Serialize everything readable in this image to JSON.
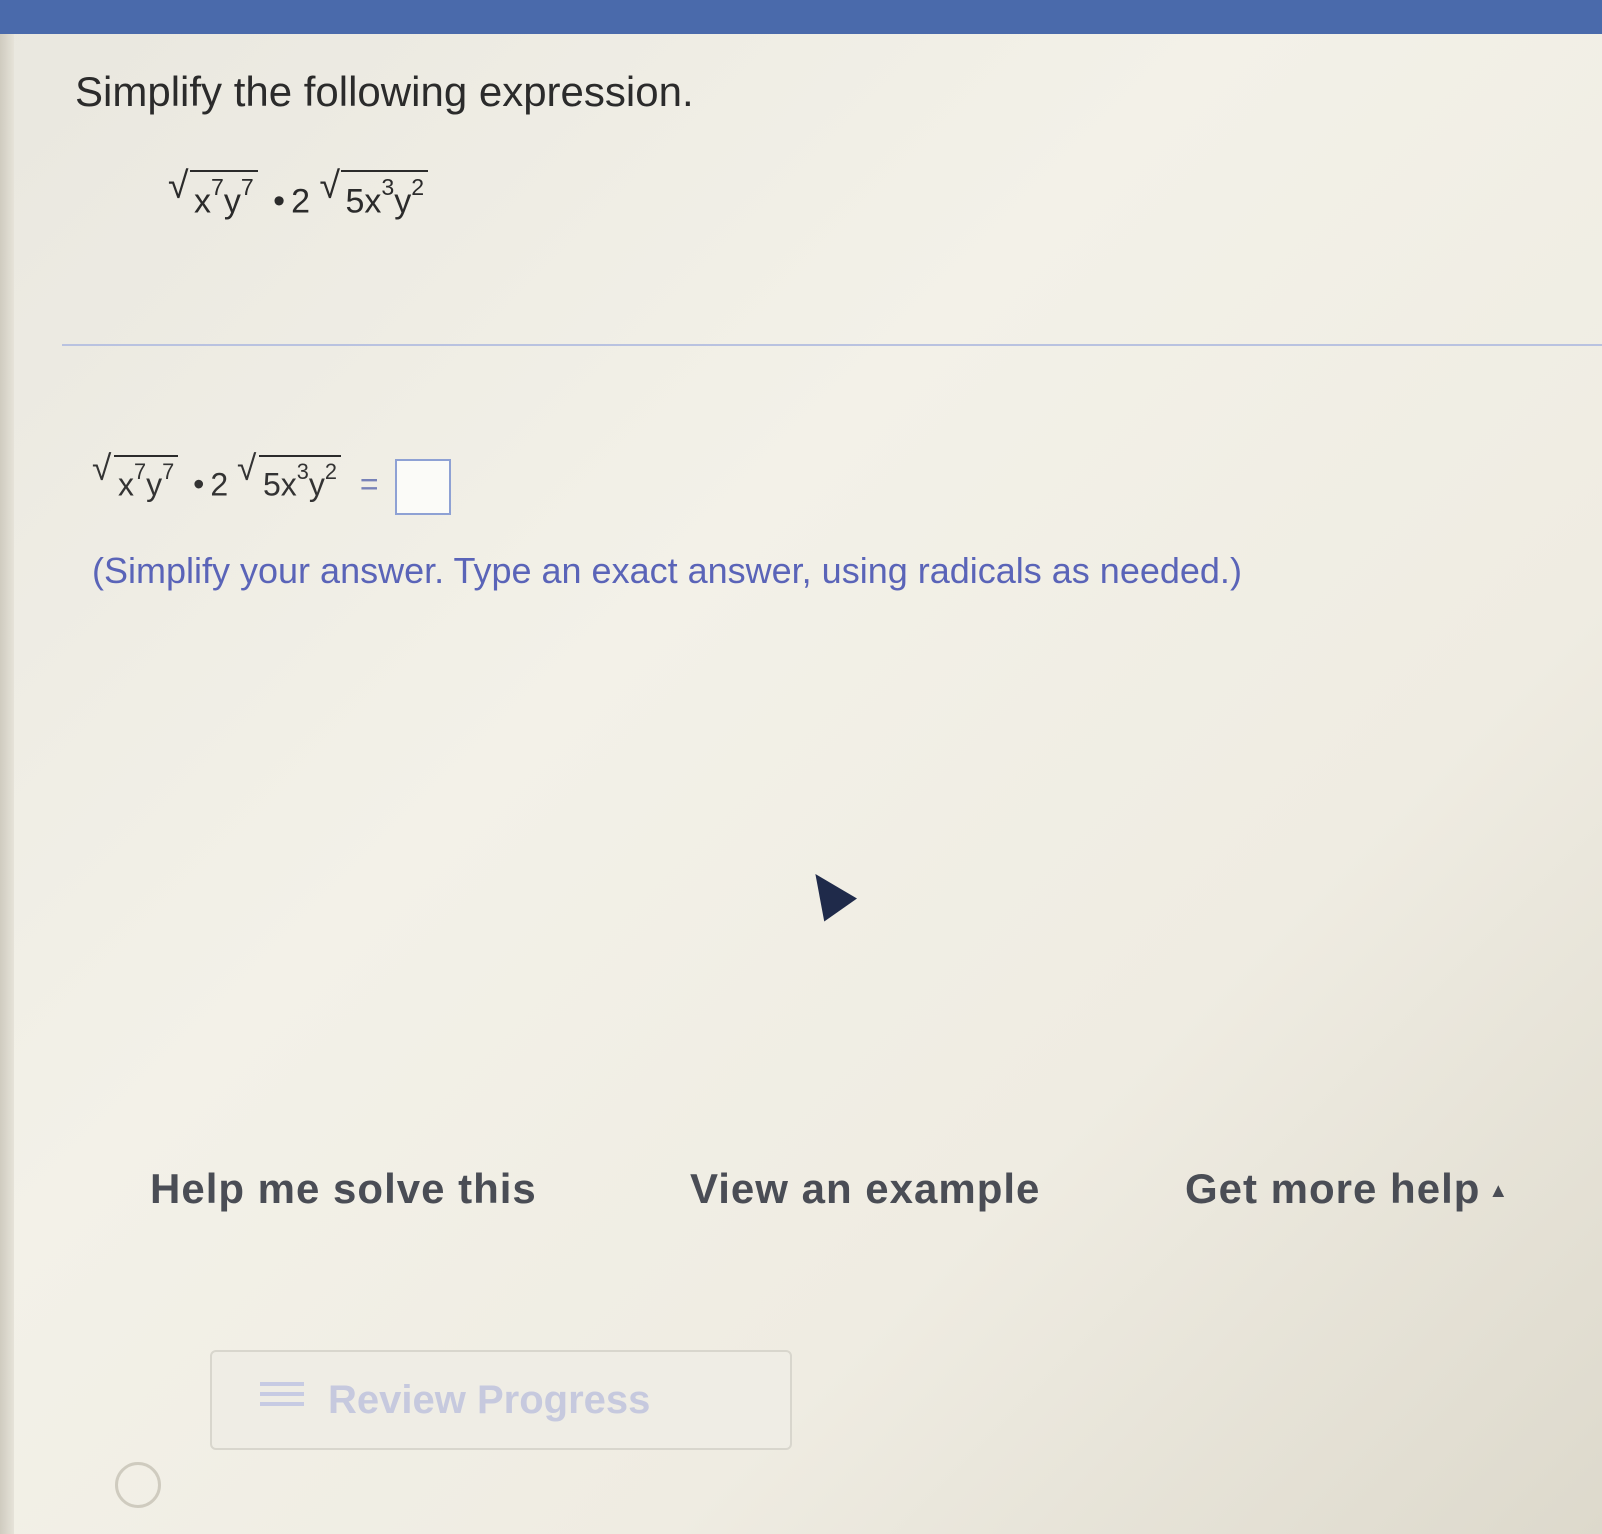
{
  "question": {
    "prompt": "Simplify the following expression."
  },
  "expression": {
    "radical1": {
      "x_exp": "7",
      "y_exp": "7"
    },
    "operator": "•",
    "coefficient": "2",
    "radical2": {
      "coef": "5",
      "x_exp": "3",
      "y_exp": "2"
    }
  },
  "answer": {
    "equals": "=",
    "instruction": "(Simplify your answer. Type an exact answer, using radicals as needed.)"
  },
  "help": {
    "solve_label": "Help me solve this",
    "example_label": "View an example",
    "more_label": "Get more help",
    "more_caret": "▲"
  },
  "review": {
    "label": "Review Progress"
  },
  "colors": {
    "top_bar": "#4a6aab",
    "instruction": "#5a64b8",
    "answer_box_border": "#8ea1d4"
  }
}
